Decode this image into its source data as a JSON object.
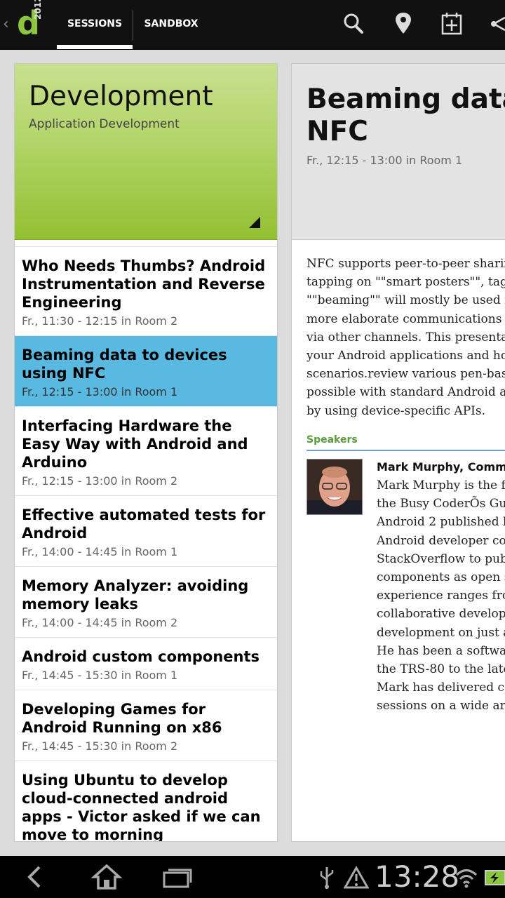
{
  "app": {
    "logo_letter": "d",
    "logo_year": "2012",
    "tabs": [
      {
        "label": "SESSIONS",
        "selected": true
      },
      {
        "label": "SANDBOX",
        "selected": false
      }
    ],
    "actions": [
      "search-icon",
      "map-pin-icon",
      "add-to-calendar-icon",
      "share-icon"
    ]
  },
  "track": {
    "title": "Development",
    "subtitle": "Application Development",
    "color": "#9cc63e"
  },
  "sessions": [
    {
      "title": "Who Needs Thumbs? Android Instrumentation and Reverse Engineering",
      "meta": "Fr., 11:30 - 12:15 in Room 2"
    },
    {
      "title": "Beaming data to devices using NFC",
      "meta": "Fr., 12:15 - 13:00 in Room 1",
      "selected": true
    },
    {
      "title": "Interfacing Hardware the Easy Way with Android and Arduino",
      "meta": "Fr., 12:15 - 13:00 in Room 2"
    },
    {
      "title": "Effective automated tests for Android",
      "meta": "Fr., 14:00 - 14:45 in Room 1"
    },
    {
      "title": "Memory Analyzer: avoiding memory leaks",
      "meta": "Fr., 14:00 - 14:45 in Room 2"
    },
    {
      "title": "Android custom components",
      "meta": "Fr., 14:45 - 15:30 in Room 1"
    },
    {
      "title": "Developing Games for Android Running on x86",
      "meta": "Fr., 14:45 - 15:30 in Room 2"
    },
    {
      "title": "Using Ubuntu to develop cloud-connected android apps - Victor asked if we can move to morning",
      "meta": ""
    }
  ],
  "detail": {
    "title_line1": "Beaming data t",
    "title_line2": "NFC",
    "meta": "Fr., 12:15 - 13:00 in Room 1",
    "abstract_lines": [
      "NFC supports peer-to-peer sharin",
      "tapping on \"\"smart posters\"\", tags",
      "\"\"beaming\"\" will mostly be used fo",
      "more elaborate communications",
      "via other channels. This presentat",
      "your Android applications and ho",
      "scenarios.review various pen-base",
      "possible with standard Android ar",
      "by using device-specific APIs."
    ],
    "speakers_label": "Speakers",
    "speaker_name": "Mark Murphy, Commo",
    "speaker_bio_lines": [
      "Mark Murphy is the fo",
      "the Busy CoderÕs Gui",
      "Android 2 published b",
      "Android developer co",
      "StackOverflow to publ",
      "components as open s",
      "experience ranges fro",
      "collaborative develop",
      "development on just a",
      "He has been a softwar",
      "the TRS-80 to the lates",
      "Mark has delivered co",
      "sessions on a wide arr"
    ]
  },
  "system": {
    "clock": "13:28"
  }
}
